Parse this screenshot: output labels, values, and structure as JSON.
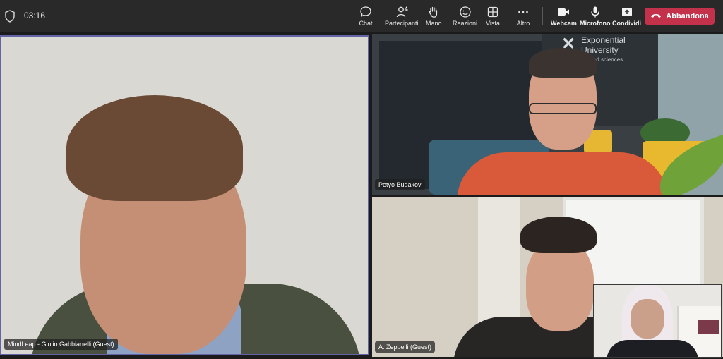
{
  "meeting": {
    "timer": "03:16"
  },
  "toolbar": {
    "chat": {
      "label": "Chat",
      "icon": "chat-icon"
    },
    "participants": {
      "label": "Partecipanti",
      "count": "4",
      "icon": "people-icon"
    },
    "hand": {
      "label": "Mano",
      "icon": "raise-hand-icon"
    },
    "reactions": {
      "label": "Reazioni",
      "icon": "smiley-icon"
    },
    "view": {
      "label": "Vista",
      "icon": "grid-icon"
    },
    "more": {
      "label": "Altro",
      "icon": "more-icon"
    },
    "webcam": {
      "label": "Webcam",
      "icon": "camera-icon"
    },
    "mic": {
      "label": "Microfono",
      "icon": "microphone-icon"
    },
    "share": {
      "label": "Condividi",
      "icon": "share-icon"
    },
    "leave": {
      "label": "Abbandona",
      "icon": "phone-hangup-icon",
      "color": "#c4314b"
    }
  },
  "participants": {
    "main": {
      "name": "MindLeap - Giulio Gabbianelli (Guest)"
    },
    "petyo": {
      "name": "Petyo Budakov",
      "background_logo": {
        "line1": "Exponential",
        "line2": "University",
        "line3": "applied sciences"
      }
    },
    "zeppelli": {
      "name": "A. Zeppelli (Guest)"
    }
  },
  "colors": {
    "accent": "#6264a7",
    "topbar": "#292929",
    "leave": "#c4314b"
  }
}
